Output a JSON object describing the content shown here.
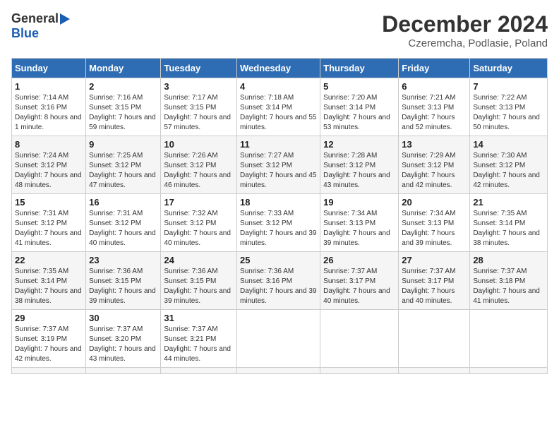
{
  "header": {
    "logo_general": "General",
    "logo_blue": "Blue",
    "month_title": "December 2024",
    "location": "Czeremcha, Podlasie, Poland"
  },
  "calendar": {
    "days_of_week": [
      "Sunday",
      "Monday",
      "Tuesday",
      "Wednesday",
      "Thursday",
      "Friday",
      "Saturday"
    ],
    "weeks": [
      [
        null,
        null,
        null,
        null,
        null,
        null,
        null
      ]
    ],
    "cells": [
      {
        "day": 1,
        "col": 0,
        "sunrise": "Sunrise: 7:14 AM",
        "sunset": "Sunset: 3:16 PM",
        "daylight": "Daylight: 8 hours and 1 minute."
      },
      {
        "day": 2,
        "col": 1,
        "sunrise": "Sunrise: 7:16 AM",
        "sunset": "Sunset: 3:15 PM",
        "daylight": "Daylight: 7 hours and 59 minutes."
      },
      {
        "day": 3,
        "col": 2,
        "sunrise": "Sunrise: 7:17 AM",
        "sunset": "Sunset: 3:15 PM",
        "daylight": "Daylight: 7 hours and 57 minutes."
      },
      {
        "day": 4,
        "col": 3,
        "sunrise": "Sunrise: 7:18 AM",
        "sunset": "Sunset: 3:14 PM",
        "daylight": "Daylight: 7 hours and 55 minutes."
      },
      {
        "day": 5,
        "col": 4,
        "sunrise": "Sunrise: 7:20 AM",
        "sunset": "Sunset: 3:14 PM",
        "daylight": "Daylight: 7 hours and 53 minutes."
      },
      {
        "day": 6,
        "col": 5,
        "sunrise": "Sunrise: 7:21 AM",
        "sunset": "Sunset: 3:13 PM",
        "daylight": "Daylight: 7 hours and 52 minutes."
      },
      {
        "day": 7,
        "col": 6,
        "sunrise": "Sunrise: 7:22 AM",
        "sunset": "Sunset: 3:13 PM",
        "daylight": "Daylight: 7 hours and 50 minutes."
      },
      {
        "day": 8,
        "col": 0,
        "sunrise": "Sunrise: 7:24 AM",
        "sunset": "Sunset: 3:12 PM",
        "daylight": "Daylight: 7 hours and 48 minutes."
      },
      {
        "day": 9,
        "col": 1,
        "sunrise": "Sunrise: 7:25 AM",
        "sunset": "Sunset: 3:12 PM",
        "daylight": "Daylight: 7 hours and 47 minutes."
      },
      {
        "day": 10,
        "col": 2,
        "sunrise": "Sunrise: 7:26 AM",
        "sunset": "Sunset: 3:12 PM",
        "daylight": "Daylight: 7 hours and 46 minutes."
      },
      {
        "day": 11,
        "col": 3,
        "sunrise": "Sunrise: 7:27 AM",
        "sunset": "Sunset: 3:12 PM",
        "daylight": "Daylight: 7 hours and 45 minutes."
      },
      {
        "day": 12,
        "col": 4,
        "sunrise": "Sunrise: 7:28 AM",
        "sunset": "Sunset: 3:12 PM",
        "daylight": "Daylight: 7 hours and 43 minutes."
      },
      {
        "day": 13,
        "col": 5,
        "sunrise": "Sunrise: 7:29 AM",
        "sunset": "Sunset: 3:12 PM",
        "daylight": "Daylight: 7 hours and 42 minutes."
      },
      {
        "day": 14,
        "col": 6,
        "sunrise": "Sunrise: 7:30 AM",
        "sunset": "Sunset: 3:12 PM",
        "daylight": "Daylight: 7 hours and 42 minutes."
      },
      {
        "day": 15,
        "col": 0,
        "sunrise": "Sunrise: 7:31 AM",
        "sunset": "Sunset: 3:12 PM",
        "daylight": "Daylight: 7 hours and 41 minutes."
      },
      {
        "day": 16,
        "col": 1,
        "sunrise": "Sunrise: 7:31 AM",
        "sunset": "Sunset: 3:12 PM",
        "daylight": "Daylight: 7 hours and 40 minutes."
      },
      {
        "day": 17,
        "col": 2,
        "sunrise": "Sunrise: 7:32 AM",
        "sunset": "Sunset: 3:12 PM",
        "daylight": "Daylight: 7 hours and 40 minutes."
      },
      {
        "day": 18,
        "col": 3,
        "sunrise": "Sunrise: 7:33 AM",
        "sunset": "Sunset: 3:12 PM",
        "daylight": "Daylight: 7 hours and 39 minutes."
      },
      {
        "day": 19,
        "col": 4,
        "sunrise": "Sunrise: 7:34 AM",
        "sunset": "Sunset: 3:13 PM",
        "daylight": "Daylight: 7 hours and 39 minutes."
      },
      {
        "day": 20,
        "col": 5,
        "sunrise": "Sunrise: 7:34 AM",
        "sunset": "Sunset: 3:13 PM",
        "daylight": "Daylight: 7 hours and 39 minutes."
      },
      {
        "day": 21,
        "col": 6,
        "sunrise": "Sunrise: 7:35 AM",
        "sunset": "Sunset: 3:14 PM",
        "daylight": "Daylight: 7 hours and 38 minutes."
      },
      {
        "day": 22,
        "col": 0,
        "sunrise": "Sunrise: 7:35 AM",
        "sunset": "Sunset: 3:14 PM",
        "daylight": "Daylight: 7 hours and 38 minutes."
      },
      {
        "day": 23,
        "col": 1,
        "sunrise": "Sunrise: 7:36 AM",
        "sunset": "Sunset: 3:15 PM",
        "daylight": "Daylight: 7 hours and 39 minutes."
      },
      {
        "day": 24,
        "col": 2,
        "sunrise": "Sunrise: 7:36 AM",
        "sunset": "Sunset: 3:15 PM",
        "daylight": "Daylight: 7 hours and 39 minutes."
      },
      {
        "day": 25,
        "col": 3,
        "sunrise": "Sunrise: 7:36 AM",
        "sunset": "Sunset: 3:16 PM",
        "daylight": "Daylight: 7 hours and 39 minutes."
      },
      {
        "day": 26,
        "col": 4,
        "sunrise": "Sunrise: 7:37 AM",
        "sunset": "Sunset: 3:17 PM",
        "daylight": "Daylight: 7 hours and 40 minutes."
      },
      {
        "day": 27,
        "col": 5,
        "sunrise": "Sunrise: 7:37 AM",
        "sunset": "Sunset: 3:17 PM",
        "daylight": "Daylight: 7 hours and 40 minutes."
      },
      {
        "day": 28,
        "col": 6,
        "sunrise": "Sunrise: 7:37 AM",
        "sunset": "Sunset: 3:18 PM",
        "daylight": "Daylight: 7 hours and 41 minutes."
      },
      {
        "day": 29,
        "col": 0,
        "sunrise": "Sunrise: 7:37 AM",
        "sunset": "Sunset: 3:19 PM",
        "daylight": "Daylight: 7 hours and 42 minutes."
      },
      {
        "day": 30,
        "col": 1,
        "sunrise": "Sunrise: 7:37 AM",
        "sunset": "Sunset: 3:20 PM",
        "daylight": "Daylight: 7 hours and 43 minutes."
      },
      {
        "day": 31,
        "col": 2,
        "sunrise": "Sunrise: 7:37 AM",
        "sunset": "Sunset: 3:21 PM",
        "daylight": "Daylight: 7 hours and 44 minutes."
      }
    ]
  }
}
